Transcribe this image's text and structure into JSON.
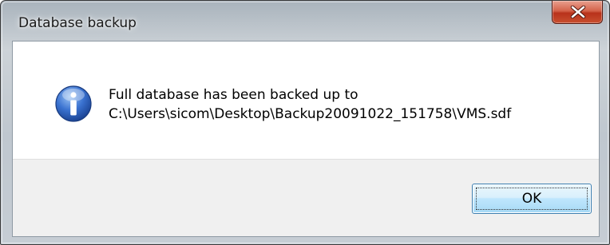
{
  "window": {
    "title": "Database backup"
  },
  "dialog": {
    "icon": "information-icon",
    "message_line1": "Full database has been backed up to",
    "message_line2": "C:\\Users\\sicom\\Desktop\\Backup20091022_151758\\VMS.sdf"
  },
  "buttons": {
    "ok_label": "OK",
    "close_icon": "close-x-icon"
  },
  "colors": {
    "close_button": "#c9502f",
    "ok_border": "#3c7fb1",
    "info_icon": "#2b5fb8"
  }
}
